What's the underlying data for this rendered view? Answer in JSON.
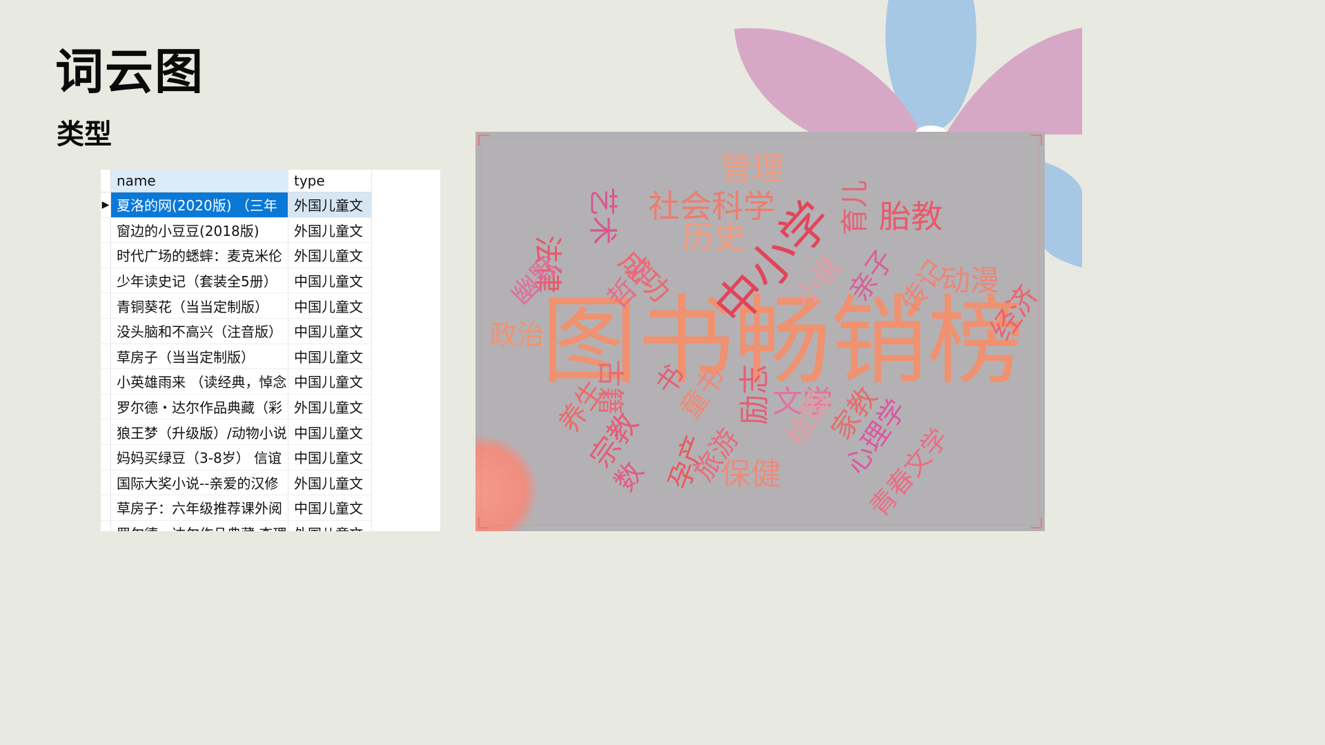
{
  "slide": {
    "title": "词云图",
    "subtitle": "类型"
  },
  "colors": {
    "background": "#e8e9e1",
    "petal_pink": "#d6a8c6",
    "petal_blue": "#a7c8e4",
    "selection": "#0a78d7",
    "cloud_bg": "#b4b1b4"
  },
  "table": {
    "columns": [
      "name",
      "type"
    ],
    "rows": [
      {
        "name": "夏洛的网(2020版) （三年",
        "type": "外国儿童文"
      },
      {
        "name": "窗边的小豆豆(2018版)",
        "type": "外国儿童文"
      },
      {
        "name": "时代广场的蟋蟀：麦克米伦",
        "type": "外国儿童文"
      },
      {
        "name": "少年读史记（套装全5册）",
        "type": "中国儿童文"
      },
      {
        "name": "青铜葵花（当当定制版）",
        "type": "中国儿童文"
      },
      {
        "name": "没头脑和不高兴（注音版）",
        "type": "中国儿童文"
      },
      {
        "name": "草房子（当当定制版）",
        "type": "中国儿童文"
      },
      {
        "name": "小英雄雨来 （读经典，悼念",
        "type": "中国儿童文"
      },
      {
        "name": "罗尔德・达尔作品典藏（彩",
        "type": "外国儿童文"
      },
      {
        "name": "狼王梦（升级版）/动物小说",
        "type": "中国儿童文"
      },
      {
        "name": "妈妈买绿豆（3-8岁） 信谊",
        "type": "中国儿童文"
      },
      {
        "name": "国际大奖小说--亲爱的汉修",
        "type": "外国儿童文"
      },
      {
        "name": "草房子：六年级推荐课外阅",
        "type": "中国儿童文"
      },
      {
        "name": "罗尔德・达尔作品典藏 查理",
        "type": "外国儿童文"
      }
    ]
  },
  "wordcloud": {
    "words": [
      {
        "text": "图书畅销榜",
        "color": "#f0916f"
      },
      {
        "text": "中小学",
        "color": "#e2445a"
      },
      {
        "text": "管理",
        "color": "#f19a80"
      },
      {
        "text": "社会科学",
        "color": "#ec7d6c"
      },
      {
        "text": "艺术",
        "color": "#d9568f"
      },
      {
        "text": "历史",
        "color": "#f29c7c"
      },
      {
        "text": "育儿",
        "color": "#e46474"
      },
      {
        "text": "胎教",
        "color": "#e85a6a"
      },
      {
        "text": "成功",
        "color": "#ea6b6d"
      },
      {
        "text": "法律",
        "color": "#e8586b"
      },
      {
        "text": "哲学",
        "color": "#e17088"
      },
      {
        "text": "幽默",
        "color": "#dd6f99"
      },
      {
        "text": "小说",
        "color": "#e89aa4"
      },
      {
        "text": "亲子",
        "color": "#d9609a"
      },
      {
        "text": "传记",
        "color": "#eb8776"
      },
      {
        "text": "动漫",
        "color": "#e88878"
      },
      {
        "text": "经济",
        "color": "#e7666e"
      },
      {
        "text": "政治",
        "color": "#f0936f"
      },
      {
        "text": "古籍",
        "color": "#e26c7a"
      },
      {
        "text": "养生",
        "color": "#e96d6a"
      },
      {
        "text": "宗教",
        "color": "#e35d7a"
      },
      {
        "text": "童书",
        "color": "#ee8a77"
      },
      {
        "text": "励志",
        "color": "#e25f76"
      },
      {
        "text": "文学",
        "color": "#e5739c"
      },
      {
        "text": "家教",
        "color": "#e46e6c"
      },
      {
        "text": "心理学",
        "color": "#da58a0"
      },
      {
        "text": "孕产",
        "color": "#e65a5d"
      },
      {
        "text": "旅游",
        "color": "#e76d7d"
      },
      {
        "text": "保健",
        "color": "#ec8b7b"
      },
      {
        "text": "绘图",
        "color": "#e89aa3"
      },
      {
        "text": "青春文学",
        "color": "#e86f84"
      },
      {
        "text": "书",
        "color": "#df6477"
      },
      {
        "text": "数",
        "color": "#e15c84"
      }
    ]
  }
}
